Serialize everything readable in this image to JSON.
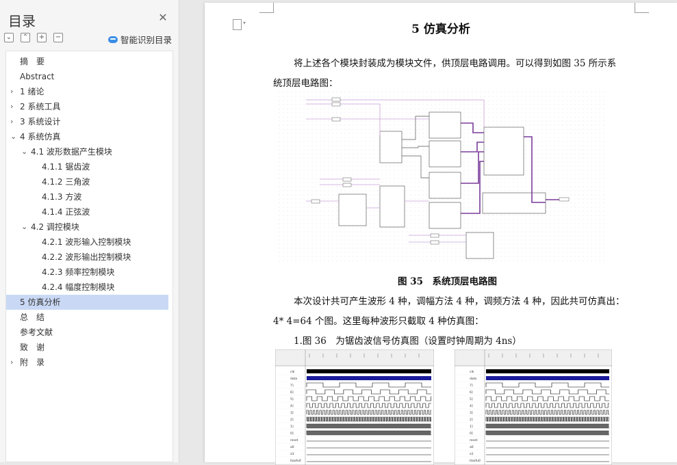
{
  "nav": {
    "title": "目录",
    "smart_label": "智能识别目录",
    "items": [
      {
        "label": "摘　要",
        "level": 0,
        "caret": ""
      },
      {
        "label": "Abstract",
        "level": 0,
        "caret": ""
      },
      {
        "label": "1 绪论",
        "level": 0,
        "caret": "›"
      },
      {
        "label": "2 系统工具",
        "level": 0,
        "caret": "›"
      },
      {
        "label": "3 系统设计",
        "level": 0,
        "caret": "›"
      },
      {
        "label": "4 系统仿真",
        "level": 0,
        "caret": "⌄"
      },
      {
        "label": "4.1  波形数据产生模块",
        "level": 1,
        "caret": "⌄"
      },
      {
        "label": "4.1.1  锯齿波",
        "level": 2,
        "caret": ""
      },
      {
        "label": "4.1.2  三角波",
        "level": 2,
        "caret": ""
      },
      {
        "label": "4.1.3  方波",
        "level": 2,
        "caret": ""
      },
      {
        "label": "4.1.4  正弦波",
        "level": 2,
        "caret": ""
      },
      {
        "label": "4.2 调控模块",
        "level": 1,
        "caret": "⌄"
      },
      {
        "label": "4.2.1 波形输入控制模块",
        "level": 2,
        "caret": ""
      },
      {
        "label": "4.2.2 波形输出控制模块",
        "level": 2,
        "caret": ""
      },
      {
        "label": "4.2.3 频率控制模块",
        "level": 2,
        "caret": ""
      },
      {
        "label": "4.2.4 幅度控制模块",
        "level": 2,
        "caret": ""
      },
      {
        "label": "5 仿真分析",
        "level": 0,
        "caret": "",
        "selected": true
      },
      {
        "label": "总　结",
        "level": 0,
        "caret": ""
      },
      {
        "label": "参考文献",
        "level": 0,
        "caret": ""
      },
      {
        "label": "致　谢",
        "level": 0,
        "caret": ""
      },
      {
        "label": "附　录",
        "level": 0,
        "caret": "›"
      }
    ]
  },
  "doc": {
    "heading": "5 仿真分析",
    "para1_line1": "将上述各个模块封装成为模块文件，供顶层电路调用。可以得到如图 35 所示系",
    "para1_line2": "统顶层电路图：",
    "figure35_caption": "图 35　系统顶层电路图",
    "para2_line1": "本次设计共可产生波形 4 种，调幅方法 4 种，调频方法 4 种，因此共可仿真出：",
    "para2_line2": "4* 4=64 个图。这里每种波形只截取 4 种仿真图：",
    "para3": "1.图 36　为锯齿波信号仿真图（设置时钟周期为 4ns）"
  },
  "sim_signals": [
    "clk",
    "data",
    "7]",
    "6]",
    "5]",
    "4]",
    "3]",
    "2]",
    "1]",
    "0]",
    "reset",
    "a0",
    "a1",
    "tiaofu0"
  ]
}
